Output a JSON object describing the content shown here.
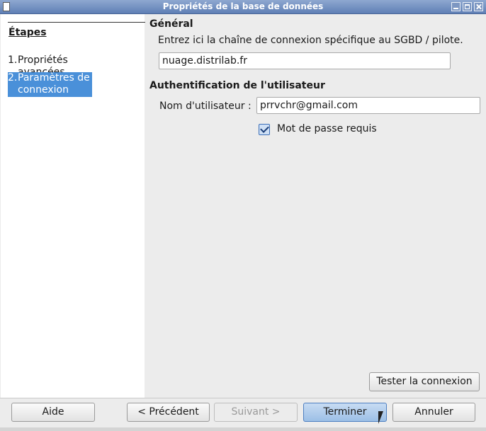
{
  "window": {
    "title": "Propriétés de la base de données"
  },
  "steps": {
    "heading": "Étapes",
    "items": [
      {
        "num": "1.",
        "label": "Propriétés avancées"
      },
      {
        "num": "2.",
        "label": "Paramètres de connexion"
      }
    ]
  },
  "general": {
    "title": "Général",
    "description": "Entrez ici la chaîne de connexion spécifique au SGBD / pilote.",
    "connection_value": "nuage.distrilab.fr"
  },
  "auth": {
    "title": "Authentification de l'utilisateur",
    "username_label": "Nom d'utilisateur :",
    "username_value": "prrvchr@gmail.com",
    "password_required_label": "Mot de passe requis",
    "password_required_checked": true
  },
  "buttons": {
    "test": "Tester la connexion",
    "help": "Aide",
    "previous": "< Précédent",
    "next": "Suivant >",
    "finish": "Terminer",
    "cancel": "Annuler"
  },
  "colors": {
    "selection": "#4a90d9",
    "titlebar": "#6f8cbf"
  }
}
